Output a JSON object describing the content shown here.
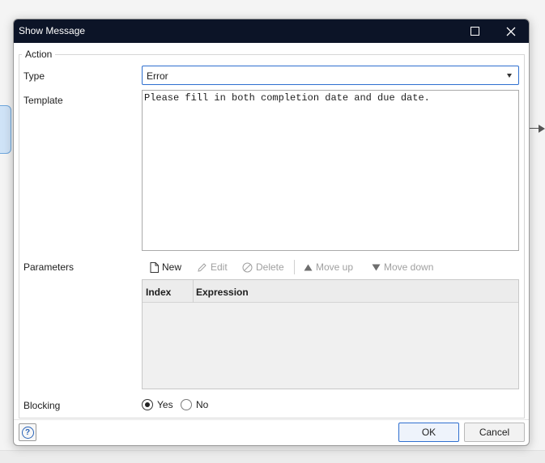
{
  "window": {
    "title": "Show Message"
  },
  "group": {
    "legend": "Action"
  },
  "type": {
    "label": "Type",
    "value": "Error"
  },
  "template": {
    "label": "Template",
    "text": "Please fill in both completion date and due date."
  },
  "parameters": {
    "label": "Parameters",
    "toolbar": {
      "new": "New",
      "edit": "Edit",
      "delete": "Delete",
      "move_up": "Move up",
      "move_down": "Move down"
    },
    "columns": [
      "Index",
      "Expression"
    ]
  },
  "blocking": {
    "label": "Blocking",
    "yes": "Yes",
    "no": "No",
    "selected": "Yes"
  },
  "buttons": {
    "ok": "OK",
    "cancel": "Cancel"
  },
  "colors": {
    "titlebar": "#0c1427",
    "accent": "#2f6fcf"
  }
}
